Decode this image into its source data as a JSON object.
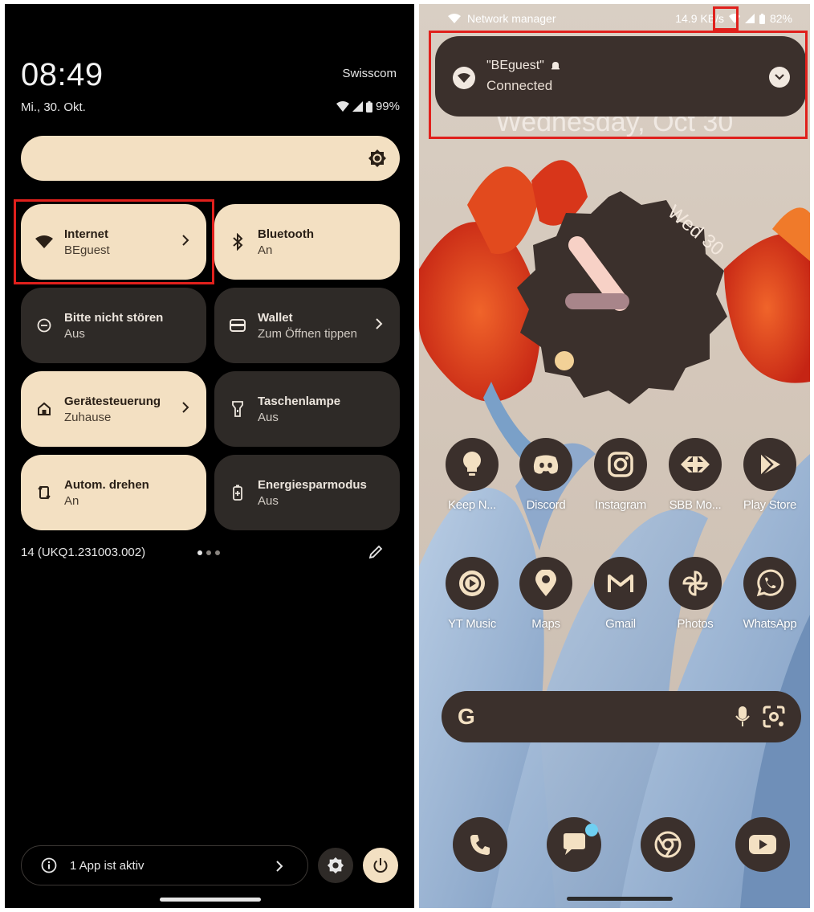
{
  "quick_settings": {
    "time": "08:49",
    "date": "Mi., 30. Okt.",
    "carrier": "Swisscom",
    "battery": "99%",
    "tiles": [
      {
        "title": "Internet",
        "subtitle": "BEguest",
        "state": "on",
        "icon": "wifi-icon",
        "chevron": true
      },
      {
        "title": "Bluetooth",
        "subtitle": "An",
        "state": "on",
        "icon": "bluetooth-icon",
        "chevron": false
      },
      {
        "title": "Bitte nicht stören",
        "subtitle": "Aus",
        "state": "off",
        "icon": "dnd-icon",
        "chevron": false
      },
      {
        "title": "Wallet",
        "subtitle": "Zum Öffnen tippen",
        "state": "off",
        "icon": "wallet-icon",
        "chevron": true
      },
      {
        "title": "Gerätesteuerung",
        "subtitle": "Zuhause",
        "state": "on",
        "icon": "home-icon",
        "chevron": true
      },
      {
        "title": "Taschenlampe",
        "subtitle": "Aus",
        "state": "off",
        "icon": "flashlight-icon",
        "chevron": false
      },
      {
        "title": "Autom. drehen",
        "subtitle": "An",
        "state": "on",
        "icon": "rotate-icon",
        "chevron": false
      },
      {
        "title": "Energiesparmodus",
        "subtitle": "Aus",
        "state": "off",
        "icon": "battery-saver-icon",
        "chevron": false
      }
    ],
    "build_number": "14 (UKQ1.231003.002)",
    "active_apps": "1 App ist aktiv"
  },
  "home": {
    "status_left": "Network manager",
    "status_speed": "14.9 KB/s",
    "battery": "82%",
    "notification": {
      "title": "\"BEguest\"",
      "subtitle": "Connected"
    },
    "date_widget": "Wednesday, Oct 30",
    "clock_date": "Wed 30",
    "apps_row1": [
      "Keep N...",
      "Discord",
      "Instagram",
      "SBB Mo...",
      "Play Store"
    ],
    "apps_row2": [
      "YT Music",
      "Maps",
      "Gmail",
      "Photos",
      "WhatsApp"
    ],
    "dock": [
      "phone-icon",
      "messages-icon",
      "chrome-icon",
      "youtube-icon"
    ]
  },
  "colors": {
    "tile_on": "#f3e0c2",
    "tile_off": "#2e2a27",
    "highlight": "#e0201c",
    "icon_bg": "#3b302c",
    "wallpaper_flower": "#d6361c",
    "wallpaper_leaf": "#9fb8d6"
  }
}
